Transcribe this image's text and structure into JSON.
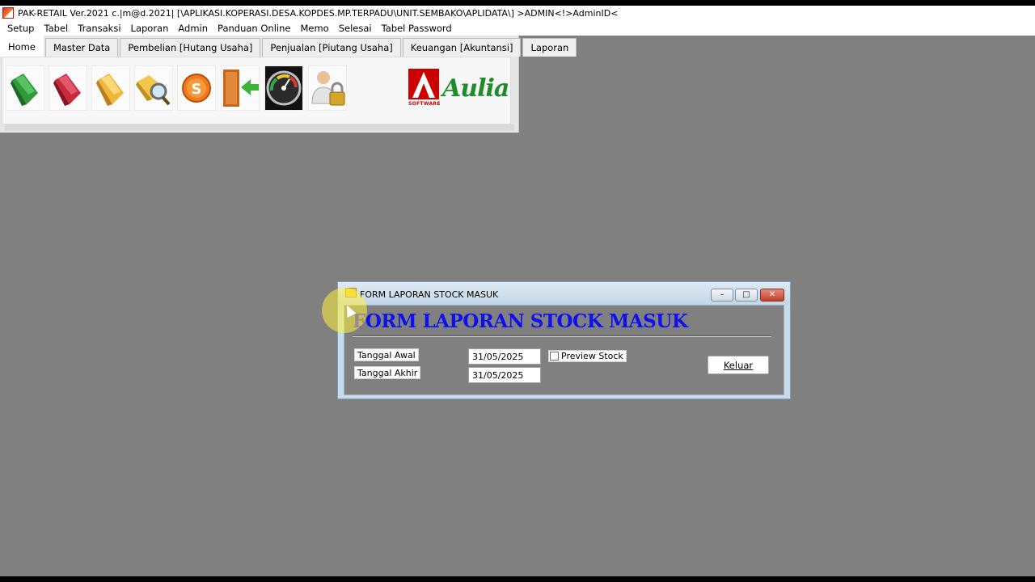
{
  "window": {
    "title": "PAK-RETAIL Ver.2021 c.|m@d.2021| [\\APLIKASI.KOPERASI.DESA.KOPDES.MP.TERPADU\\UNIT.SEMBAKO\\APLIDATA\\] >ADMIN<!>AdminID<"
  },
  "menubar": {
    "items": [
      "Setup",
      "Tabel",
      "Transaksi",
      "Laporan",
      "Admin",
      "Panduan Online",
      "Memo",
      "Selesai",
      "Tabel Password"
    ]
  },
  "ribbon": {
    "tabs": [
      "Home",
      "Master Data",
      "Pembelian [Hutang Usaha]",
      "Penjualan [Piutang Usaha]",
      "Keuangan [Akuntansi]",
      "Laporan"
    ],
    "active_tab": "Home",
    "tool_icons": [
      "green-folder-icon",
      "red-folder-icon",
      "yellow-folder-icon",
      "folder-search-icon",
      "coin-s-icon",
      "exit-door-icon",
      "speedometer-icon",
      "user-lock-icon"
    ],
    "logo_text": "Aulia",
    "logo_sub": "SOFTWARE"
  },
  "dialog": {
    "title": "FORM LAPORAN STOCK MASUK",
    "heading": "FORM LAPORAN STOCK MASUK",
    "tanggal_awal_label": "Tanggal Awal",
    "tanggal_akhir_label": "Tanggal Akhir",
    "tanggal_awal_value": "31/05/2025",
    "tanggal_akhir_value": "31/05/2025",
    "preview_stock_label": "Preview Stock",
    "preview_stock_checked": false,
    "keluar_label": "Keluar"
  },
  "colors": {
    "desktop_bg": "#808080",
    "heading_blue": "#1010ee",
    "logo_green": "#1e8c2a",
    "logo_red": "#cc0000"
  }
}
